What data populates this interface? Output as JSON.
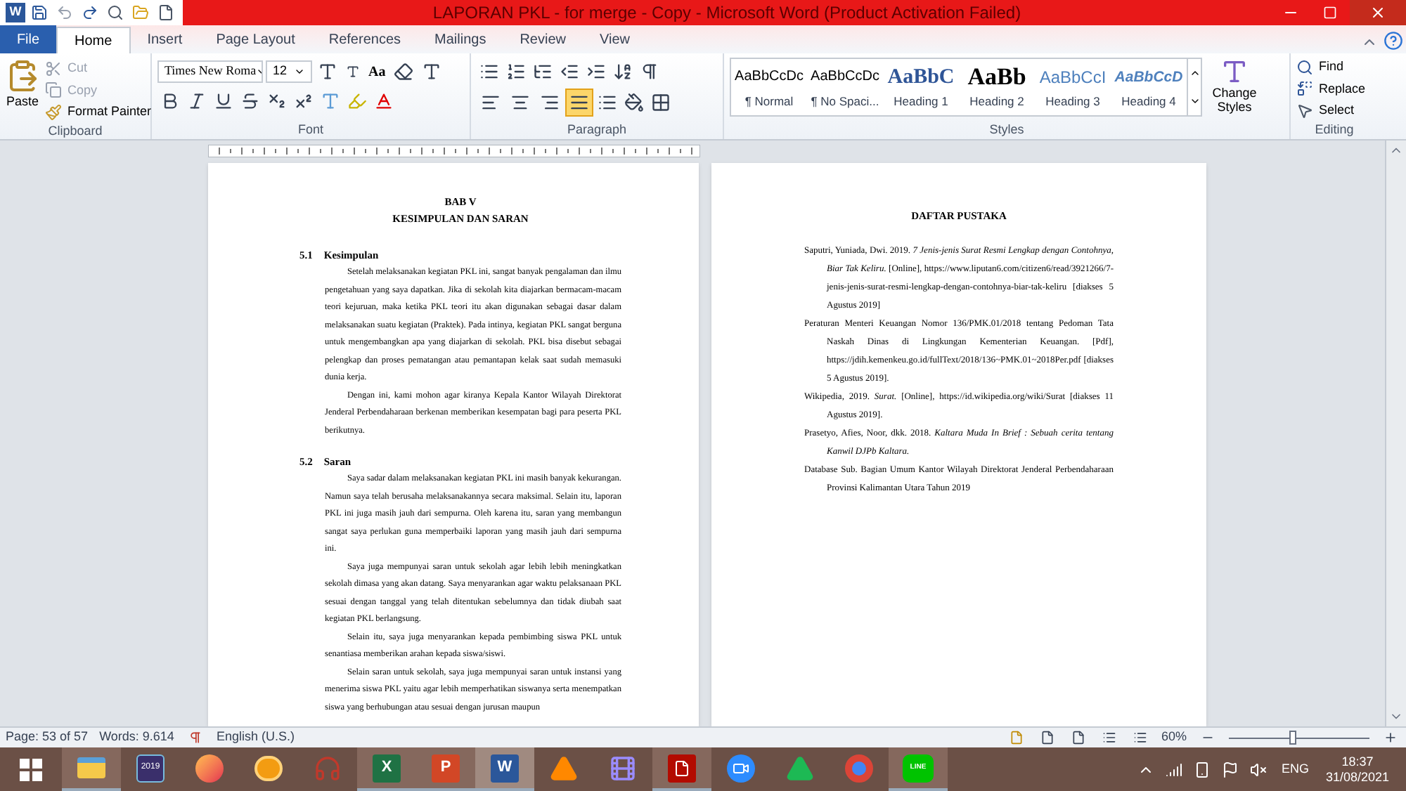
{
  "title_bar": {
    "logo": "W",
    "title": "LAPORAN PKL - for merge - Copy - Microsoft Word (Product Activation Failed)"
  },
  "tabs": [
    {
      "label": "File",
      "kind": "file",
      "selected": false
    },
    {
      "label": "Home",
      "kind": "tab",
      "selected": true
    },
    {
      "label": "Insert",
      "kind": "tab",
      "selected": false
    },
    {
      "label": "Page Layout",
      "kind": "tab",
      "selected": false
    },
    {
      "label": "References",
      "kind": "tab",
      "selected": false
    },
    {
      "label": "Mailings",
      "kind": "tab",
      "selected": false
    },
    {
      "label": "Review",
      "kind": "tab",
      "selected": false
    },
    {
      "label": "View",
      "kind": "tab",
      "selected": false
    }
  ],
  "ribbon": {
    "clipboard": {
      "paste": "Paste",
      "cut": "Cut",
      "copy": "Copy",
      "format_painter": "Format Painter",
      "label": "Clipboard"
    },
    "font": {
      "name": "Times New Roma",
      "size": "12",
      "change_case": "Aa",
      "label": "Font"
    },
    "paragraph": {
      "label": "Paragraph",
      "alignments": [
        {
          "kind": "left",
          "selected": false
        },
        {
          "kind": "center",
          "selected": false
        },
        {
          "kind": "right",
          "selected": false
        },
        {
          "kind": "justify",
          "selected": true
        }
      ]
    },
    "styles": {
      "label": "Styles",
      "change_styles": "Change Styles",
      "items": [
        {
          "preview": "AaBbCcDc",
          "name": "¶ Normal",
          "kind": "normal"
        },
        {
          "preview": "AaBbCcDc",
          "name": "¶ No Spaci...",
          "kind": "normal"
        },
        {
          "preview": "AaBbC",
          "name": "Heading 1",
          "kind": "h1"
        },
        {
          "preview": "AaBb",
          "name": "Heading 2",
          "kind": "h2"
        },
        {
          "preview": "AaBbCcI",
          "name": "Heading 3",
          "kind": "h3"
        },
        {
          "preview": "AaBbCcD",
          "name": "Heading 4",
          "kind": "h4"
        }
      ]
    },
    "editing": {
      "label": "Editing",
      "find": "Find",
      "replace": "Replace",
      "select": "Select"
    }
  },
  "page_left": {
    "chapter": "BAB V",
    "title": "KESIMPULAN DAN SARAN",
    "sections": [
      {
        "number": "5.1",
        "heading": "Kesimpulan",
        "paragraphs": [
          "Setelah melaksanakan kegiatan PKL ini, sangat banyak pengalaman dan ilmu pengetahuan yang saya dapatkan. Jika di sekolah kita diajarkan bermacam-macam teori kejuruan, maka ketika PKL teori itu akan digunakan sebagai dasar dalam melaksanakan suatu kegiatan (Praktek). Pada intinya, kegiatan PKL sangat berguna untuk mengembangkan apa yang diajarkan di sekolah. PKL bisa disebut sebagai pelengkap dan proses pematangan atau pemantapan kelak saat sudah memasuki dunia kerja.",
          "Dengan ini, kami mohon agar kiranya Kepala Kantor Wilayah Direktorat Jenderal Perbendaharaan berkenan memberikan kesempatan bagi para peserta PKL berikutnya."
        ]
      },
      {
        "number": "5.2",
        "heading": "Saran",
        "paragraphs": [
          "Saya sadar dalam melaksanakan kegiatan PKL ini masih banyak kekurangan. Namun saya telah berusaha melaksanakannya secara maksimal. Selain itu, laporan PKL ini juga masih jauh dari sempurna. Oleh karena itu, saran yang membangun sangat saya perlukan guna memperbaiki laporan yang masih jauh dari sempurna ini.",
          "Saya juga mempunyai saran untuk sekolah agar lebih lebih meningkatkan sekolah dimasa yang akan datang. Saya menyarankan agar waktu pelaksanaan PKL sesuai dengan tanggal yang telah ditentukan sebelumnya dan tidak diubah saat kegiatan PKL berlangsung.",
          "Selain itu, saya juga menyarankan kepada pembimbing siswa PKL untuk senantiasa memberikan arahan kepada siswa/siswi.",
          "Selain saran untuk sekolah, saya juga mempunyai saran untuk instansi yang menerima siswa PKL yaitu agar lebih memperhatikan siswanya serta menempatkan siswa yang berhubungan atau sesuai dengan jurusan maupun"
        ]
      }
    ]
  },
  "page_right": {
    "title": "DAFTAR PUSTAKA",
    "references": [
      "Saputri, Yuniada, Dwi. 2019. *7 Jenis-jenis Surat Resmi Lengkap dengan Contohnya, Biar Tak Keliru.* [Online], https://www.liputan6.com/citizen6/read/3921266/7-jenis-jenis-surat-resmi-lengkap-dengan-contohnya-biar-tak-keliru [diakses 5 Agustus 2019]",
      "Peraturan Menteri Keuangan Nomor 136/PMK.01/2018 tentang Pedoman Tata Naskah Dinas di Lingkungan Kementerian Keuangan. [Pdf], https://jdih.kemenkeu.go.id/fullText/2018/136~PMK.01~2018Per.pdf [diakses 5 Agustus 2019].",
      "Wikipedia, 2019. *Surat.* [Online], https://id.wikipedia.org/wiki/Surat [diakses 11 Agustus 2019].",
      "Prasetyo, Afies, Noor, dkk. 2018. *Kaltara Muda In Brief : Sebuah cerita tentang Kanwil DJPb Kaltara.*",
      "Database Sub. Bagian Umum Kantor Wilayah Direktorat Jenderal Perbendaharaan Provinsi Kalimantan Utara Tahun 2019"
    ]
  },
  "status_bar": {
    "page": "Page: 53 of 57",
    "words": "Words: 9.614",
    "language": "English (U.S.)",
    "zoom": "60%",
    "zoom_slider": {
      "level": 0.45
    }
  },
  "taskbar": {
    "apps": [
      {
        "kind": "explorer",
        "running": true,
        "selected": false
      },
      {
        "kind": "calendar",
        "glyph": "2019",
        "running": false,
        "selected": false
      },
      {
        "kind": "firefox",
        "running": false,
        "selected": false
      },
      {
        "kind": "ball",
        "running": false,
        "selected": false
      },
      {
        "kind": "headphones",
        "running": false,
        "selected": false
      },
      {
        "kind": "excel",
        "glyph": "X",
        "running": true,
        "selected": false
      },
      {
        "kind": "powerpoint",
        "glyph": "P",
        "running": true,
        "selected": false
      },
      {
        "kind": "word",
        "glyph": "W",
        "running": true,
        "selected": true
      },
      {
        "kind": "vlc",
        "running": false,
        "selected": false
      },
      {
        "kind": "film",
        "running": false,
        "selected": false
      },
      {
        "kind": "pdf",
        "running": true,
        "selected": false
      },
      {
        "kind": "zoom",
        "running": false,
        "selected": false
      },
      {
        "kind": "triangle",
        "running": false,
        "selected": false
      },
      {
        "kind": "chrome",
        "running": false,
        "selected": false
      },
      {
        "kind": "chat",
        "glyph": "LINE",
        "running": true,
        "selected": false
      }
    ],
    "language": "ENG",
    "time": "18:37",
    "date": "31/08/2021"
  }
}
